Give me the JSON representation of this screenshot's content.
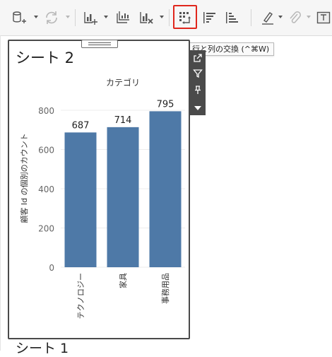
{
  "toolbar": {
    "tooltip": "行と列の交換 (^⌘W)",
    "buttons": [
      {
        "icon": "datasource-icon"
      },
      {
        "icon": "refresh-icon"
      },
      {
        "icon": "new-worksheet-icon"
      },
      {
        "icon": "duplicate-sheet-icon"
      },
      {
        "icon": "clear-sheet-icon"
      },
      {
        "icon": "swap-rows-columns-icon"
      },
      {
        "icon": "sort-ascending-icon"
      },
      {
        "icon": "sort-descending-icon"
      },
      {
        "icon": "highlight-icon"
      },
      {
        "icon": "attach-icon"
      },
      {
        "icon": "show-labels-icon"
      }
    ]
  },
  "sheets": {
    "current_title": "シート 2",
    "next_title": "シート 1"
  },
  "side_toolbar": {
    "icons": [
      "open-external-icon",
      "filter-icon",
      "pin-icon",
      "more-menu-icon"
    ]
  },
  "chart_data": {
    "type": "bar",
    "column_header": "カテゴリ",
    "categories": [
      "テクノロジー",
      "家具",
      "事務用品"
    ],
    "values": [
      687,
      714,
      795
    ],
    "data_labels": [
      "687",
      "714",
      "795"
    ],
    "ylabel": "顧客 Id の個別のカウント",
    "yticks": [
      "0",
      "200",
      "400",
      "600",
      "800"
    ],
    "ylim": [
      0,
      800
    ],
    "grid": true,
    "bar_color": "#4e79a7"
  }
}
